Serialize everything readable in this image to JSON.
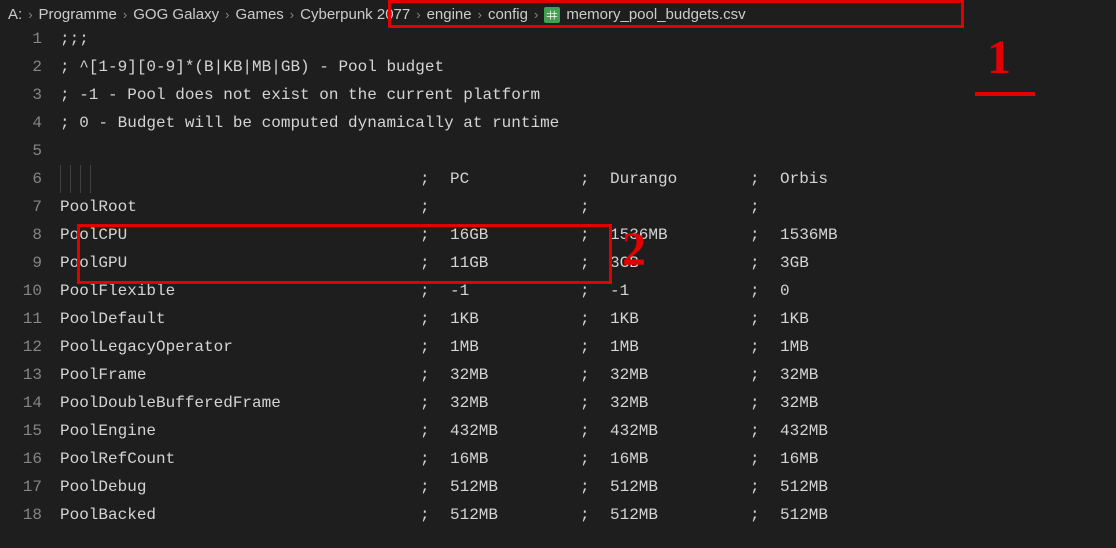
{
  "breadcrumb": {
    "items": [
      {
        "label": "A:"
      },
      {
        "label": "Programme"
      },
      {
        "label": "GOG Galaxy"
      },
      {
        "label": "Games"
      },
      {
        "label": "Cyberpunk 2077"
      },
      {
        "label": "engine"
      },
      {
        "label": "config"
      },
      {
        "label": "memory_pool_budgets.csv",
        "icon": "csv"
      }
    ]
  },
  "comments": {
    "l1": ";;;",
    "l2": "; ^[1-9][0-9]*(B|KB|MB|GB) - Pool budget",
    "l3": "; -1 - Pool does not exist on the current platform",
    "l4": "; 0 - Budget will be computed dynamically at runtime"
  },
  "columns": {
    "c1": "PC",
    "c2": "Durango",
    "c3": "Orbis"
  },
  "sep": ";",
  "rows": [
    {
      "num": "7",
      "name": "PoolRoot",
      "pc": "",
      "durango": "",
      "orbis": ""
    },
    {
      "num": "8",
      "name": "PoolCPU",
      "pc": "16GB",
      "durango": "1536MB",
      "orbis": "1536MB"
    },
    {
      "num": "9",
      "name": "PoolGPU",
      "pc": "11GB",
      "durango": "3GB",
      "orbis": "3GB"
    },
    {
      "num": "10",
      "name": "PoolFlexible",
      "pc": "-1",
      "durango": "-1",
      "orbis": "0"
    },
    {
      "num": "11",
      "name": "PoolDefault",
      "pc": "1KB",
      "durango": "1KB",
      "orbis": "1KB"
    },
    {
      "num": "12",
      "name": "PoolLegacyOperator",
      "pc": "1MB",
      "durango": "1MB",
      "orbis": "1MB"
    },
    {
      "num": "13",
      "name": "PoolFrame",
      "pc": "32MB",
      "durango": "32MB",
      "orbis": "32MB"
    },
    {
      "num": "14",
      "name": "PoolDoubleBufferedFrame",
      "pc": "32MB",
      "durango": "32MB",
      "orbis": "32MB"
    },
    {
      "num": "15",
      "name": "PoolEngine",
      "pc": "432MB",
      "durango": "432MB",
      "orbis": "432MB"
    },
    {
      "num": "16",
      "name": "PoolRefCount",
      "pc": "16MB",
      "durango": "16MB",
      "orbis": "16MB"
    },
    {
      "num": "17",
      "name": "PoolDebug",
      "pc": "512MB",
      "durango": "512MB",
      "orbis": "512MB"
    },
    {
      "num": "18",
      "name": "PoolBacked",
      "pc": "512MB",
      "durango": "512MB",
      "orbis": "512MB"
    }
  ],
  "annotations": {
    "label1": "1",
    "label2": "2"
  }
}
